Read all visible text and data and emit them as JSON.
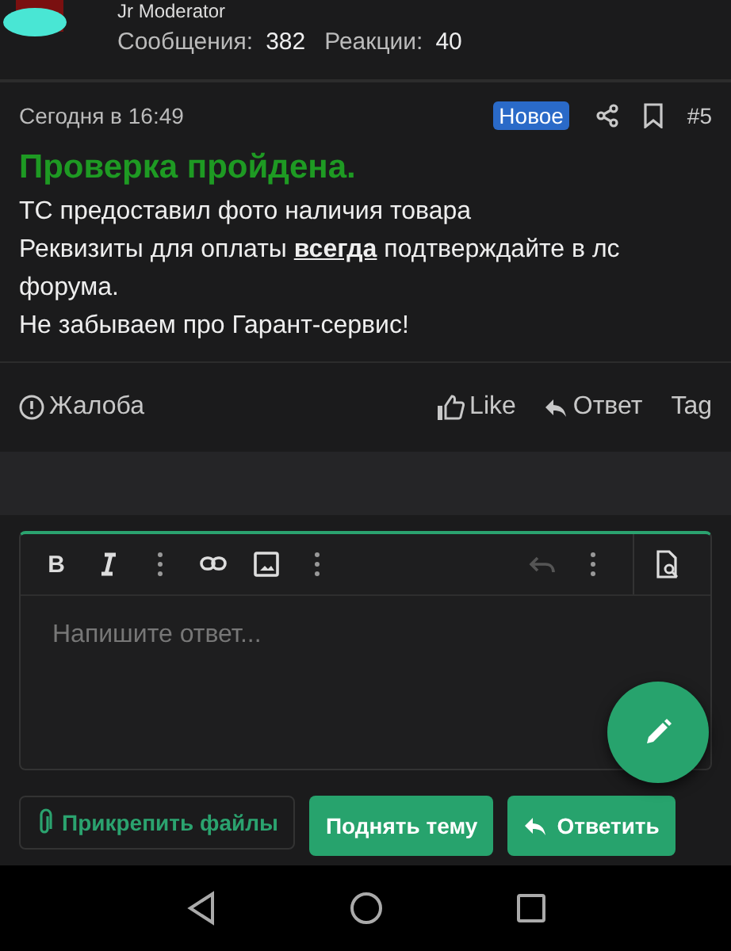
{
  "author": {
    "role": "Jr Moderator",
    "stats": [
      {
        "label": "Сообщения:",
        "value": "382"
      },
      {
        "label": "Реакции:",
        "value": "40"
      }
    ]
  },
  "post": {
    "time": "Сегодня в 16:49",
    "badge": "Новое",
    "number": "#5",
    "title": "Проверка пройдена.",
    "paragraphs": [
      "ТС предоставил фото наличия товара",
      "Реквизиты для оплаты **всегда** подтверждайте в лс форума.",
      "Не забываем про Гарант-сервис!"
    ],
    "actions": {
      "report": "Жалоба",
      "like": "Like",
      "reply": "Ответ",
      "tag": "Tag"
    }
  },
  "editor": {
    "placeholder": "Напишите ответ...",
    "toolbar": [
      {
        "kind": "bold",
        "label": "B"
      },
      {
        "kind": "italic"
      },
      {
        "kind": "more"
      },
      {
        "kind": "link"
      },
      {
        "kind": "image"
      },
      {
        "kind": "more"
      },
      {
        "kind": "spacer"
      },
      {
        "kind": "undo",
        "disabled": true
      },
      {
        "kind": "more"
      },
      {
        "kind": "preview"
      }
    ]
  },
  "buttons": {
    "attach": "Прикрепить файлы",
    "bump": "Поднять тему",
    "reply": "Ответить"
  }
}
